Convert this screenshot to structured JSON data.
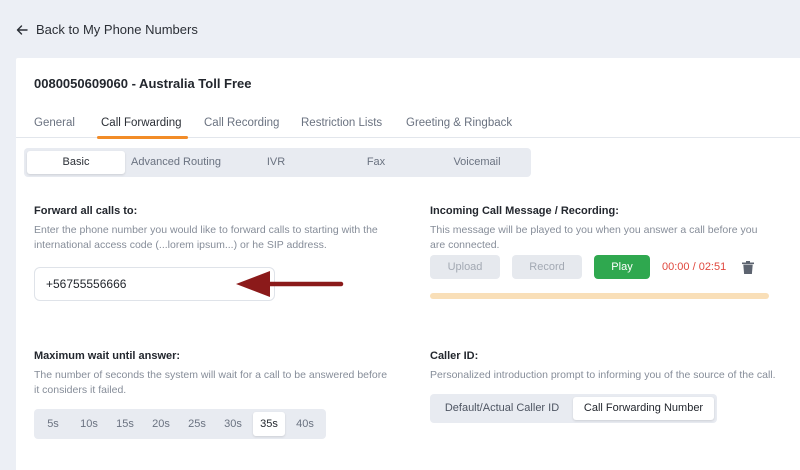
{
  "nav": {
    "back_label": "Back to My Phone Numbers",
    "back_icon": "arrow-left-icon"
  },
  "header": {
    "title": "0080050609060 - Australia Toll Free"
  },
  "tabs": [
    {
      "label": "General"
    },
    {
      "label": "Call Forwarding",
      "active": true
    },
    {
      "label": "Call Recording"
    },
    {
      "label": "Restriction Lists"
    },
    {
      "label": "Greeting & Ringback"
    }
  ],
  "subtabs": [
    {
      "label": "Basic",
      "active": true
    },
    {
      "label": "Advanced Routing"
    },
    {
      "label": "IVR"
    },
    {
      "label": "Fax"
    },
    {
      "label": "Voicemail"
    }
  ],
  "forward": {
    "label": "Forward all calls to:",
    "description": "Enter the phone number you would like to forward calls to starting with the international access code (...lorem ipsum...) or he SIP address.",
    "value": "+56755556666"
  },
  "incoming": {
    "label": "Incoming Call Message / Recording:",
    "description": "This message will be played to you when you answer a call before you are connected.",
    "upload_label": "Upload",
    "record_label": "Record",
    "play_label": "Play",
    "timer": "00:00 / 02:51",
    "progress": 0
  },
  "wait": {
    "label": "Maximum wait until answer:",
    "description": "The number of seconds the system will wait for a call to be answered before it considers it failed.",
    "options": [
      "5s",
      "10s",
      "15s",
      "20s",
      "25s",
      "30s",
      "35s",
      "40s"
    ],
    "selected": "35s"
  },
  "caller_id": {
    "label": "Caller ID:",
    "description": "Personalized introduction prompt to informing you of the source of the call.",
    "options": [
      "Default/Actual Caller ID",
      "Call Forwarding Number"
    ],
    "selected": "Call Forwarding Number"
  },
  "colors": {
    "accent": "#f28c28",
    "play": "#2fa84f",
    "timer": "#e0483e",
    "annotation_arrow": "#8b1a1a"
  }
}
